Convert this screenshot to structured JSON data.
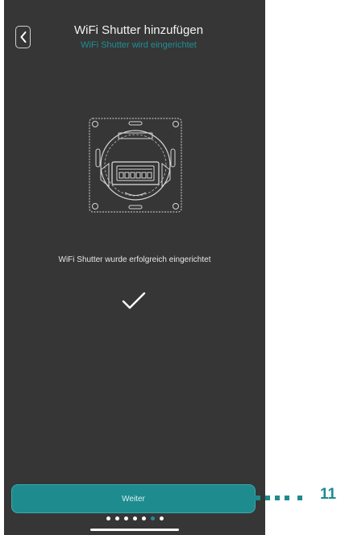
{
  "header": {
    "title": "WiFi Shutter hinzufügen",
    "subtitle": "WiFi Shutter wird eingerichtet",
    "back_icon": "chevron-left-icon"
  },
  "device_illustration": {
    "icon": "wifi-shutter-device-icon"
  },
  "status": {
    "message": "WiFi Shutter wurde erfolgreich eingerichtet",
    "icon": "checkmark-icon"
  },
  "footer": {
    "next_label": "Weiter",
    "page_count": 7,
    "active_page": 6
  },
  "annotation": {
    "number": "11"
  },
  "colors": {
    "background": "#363636",
    "accent": "#1e8b8f",
    "text": "#f2f2f2"
  }
}
